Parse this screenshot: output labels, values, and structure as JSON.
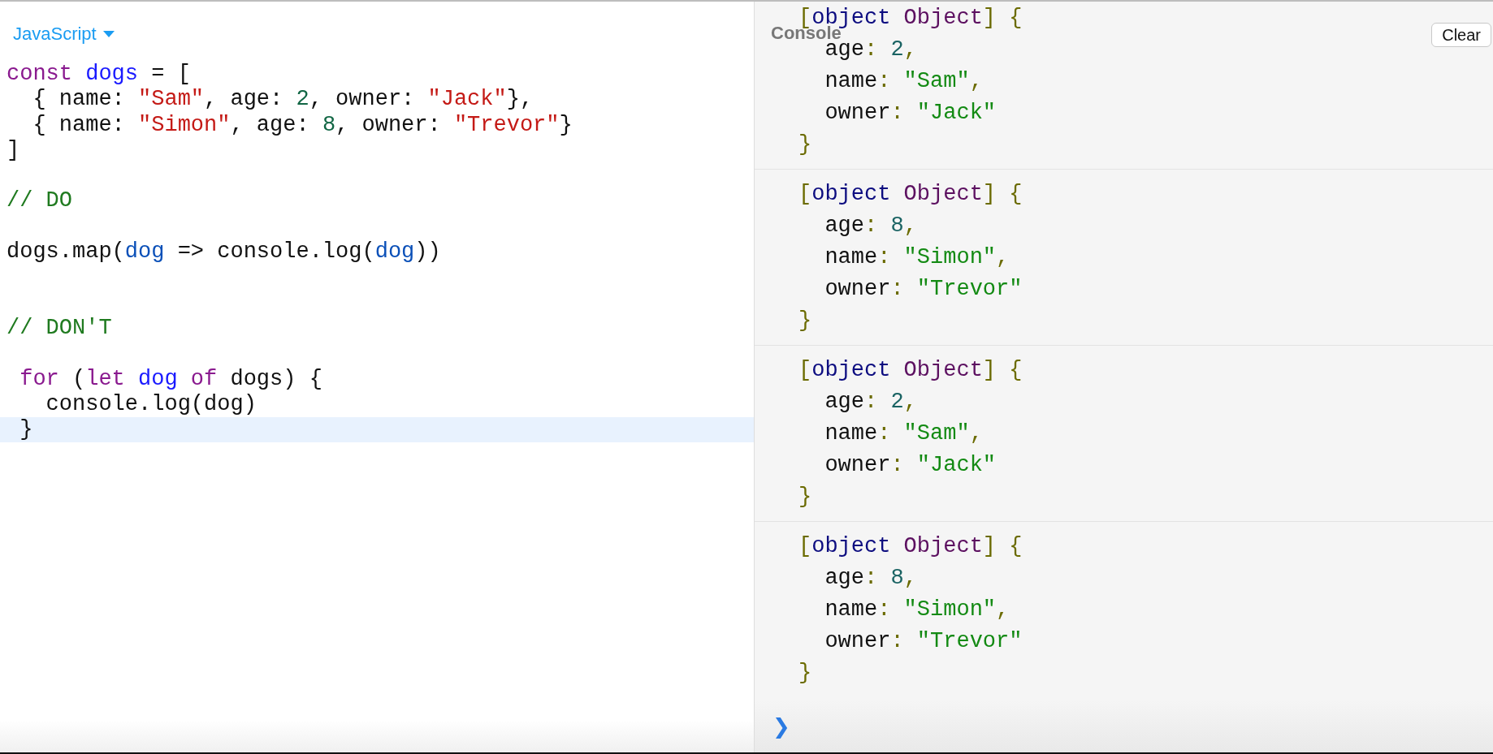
{
  "editor": {
    "language": "JavaScript",
    "lines": [
      {
        "kind": "code",
        "highlighted": false,
        "tokens": [
          {
            "kind": "keyword",
            "text": "const"
          },
          {
            "kind": "def",
            "text": " dogs"
          },
          {
            "kind": "plain",
            "text": " = ["
          }
        ]
      },
      {
        "kind": "code",
        "highlighted": false,
        "tokens": [
          {
            "kind": "plain",
            "text": "  { name: "
          },
          {
            "kind": "string",
            "text": "\"Sam\""
          },
          {
            "kind": "plain",
            "text": ", age: "
          },
          {
            "kind": "number",
            "text": "2"
          },
          {
            "kind": "plain",
            "text": ", owner: "
          },
          {
            "kind": "string",
            "text": "\"Jack\""
          },
          {
            "kind": "plain",
            "text": "},"
          }
        ]
      },
      {
        "kind": "code",
        "highlighted": false,
        "tokens": [
          {
            "kind": "plain",
            "text": "  { name: "
          },
          {
            "kind": "string",
            "text": "\"Simon\""
          },
          {
            "kind": "plain",
            "text": ", age: "
          },
          {
            "kind": "number",
            "text": "8"
          },
          {
            "kind": "plain",
            "text": ", owner: "
          },
          {
            "kind": "string",
            "text": "\"Trevor\""
          },
          {
            "kind": "plain",
            "text": "}"
          }
        ]
      },
      {
        "kind": "code",
        "highlighted": false,
        "tokens": [
          {
            "kind": "plain",
            "text": "]"
          }
        ]
      },
      {
        "kind": "blank"
      },
      {
        "kind": "code",
        "highlighted": false,
        "tokens": [
          {
            "kind": "comment",
            "text": "// DO"
          }
        ]
      },
      {
        "kind": "blank"
      },
      {
        "kind": "code",
        "highlighted": false,
        "tokens": [
          {
            "kind": "plain",
            "text": "dogs.map("
          },
          {
            "kind": "variable",
            "text": "dog"
          },
          {
            "kind": "plain",
            "text": " => console.log("
          },
          {
            "kind": "variable",
            "text": "dog"
          },
          {
            "kind": "plain",
            "text": "))"
          }
        ]
      },
      {
        "kind": "blank"
      },
      {
        "kind": "blank"
      },
      {
        "kind": "code",
        "highlighted": false,
        "tokens": [
          {
            "kind": "comment",
            "text": "// DON'T"
          }
        ]
      },
      {
        "kind": "blank"
      },
      {
        "kind": "code",
        "highlighted": false,
        "tokens": [
          {
            "kind": "keyword",
            "text": " for"
          },
          {
            "kind": "plain",
            "text": " ("
          },
          {
            "kind": "keyword",
            "text": "let"
          },
          {
            "kind": "def",
            "text": " dog"
          },
          {
            "kind": "keyword",
            "text": " of"
          },
          {
            "kind": "plain",
            "text": " dogs) {"
          }
        ]
      },
      {
        "kind": "code",
        "highlighted": false,
        "tokens": [
          {
            "kind": "plain",
            "text": "   console.log(dog)"
          }
        ]
      },
      {
        "kind": "code",
        "highlighted": true,
        "tokens": [
          {
            "kind": "plain",
            "text": " }"
          }
        ]
      }
    ]
  },
  "console": {
    "title": "Console",
    "clear_button": "Clear",
    "entries": [
      {
        "lines": [
          [
            {
              "kind": "punct",
              "text": "["
            },
            {
              "kind": "type",
              "text": "object"
            },
            {
              "kind": "class",
              "text": " Object"
            },
            {
              "kind": "punct",
              "text": "]"
            },
            {
              "kind": "punct",
              "text": " {"
            }
          ],
          [
            {
              "kind": "key",
              "text": "  age"
            },
            {
              "kind": "punct",
              "text": ":"
            },
            {
              "kind": "num_value",
              "text": " 2"
            },
            {
              "kind": "punct",
              "text": ","
            }
          ],
          [
            {
              "kind": "key",
              "text": "  name"
            },
            {
              "kind": "punct",
              "text": ":"
            },
            {
              "kind": "text_value",
              "text": " \"Sam\""
            },
            {
              "kind": "punct",
              "text": ","
            }
          ],
          [
            {
              "kind": "key",
              "text": "  owner"
            },
            {
              "kind": "punct",
              "text": ":"
            },
            {
              "kind": "text_value",
              "text": " \"Jack\""
            }
          ],
          [
            {
              "kind": "punct",
              "text": "}"
            }
          ]
        ]
      },
      {
        "lines": [
          [
            {
              "kind": "punct",
              "text": "["
            },
            {
              "kind": "type",
              "text": "object"
            },
            {
              "kind": "class",
              "text": " Object"
            },
            {
              "kind": "punct",
              "text": "]"
            },
            {
              "kind": "punct",
              "text": " {"
            }
          ],
          [
            {
              "kind": "key",
              "text": "  age"
            },
            {
              "kind": "punct",
              "text": ":"
            },
            {
              "kind": "num_value",
              "text": " 8"
            },
            {
              "kind": "punct",
              "text": ","
            }
          ],
          [
            {
              "kind": "key",
              "text": "  name"
            },
            {
              "kind": "punct",
              "text": ":"
            },
            {
              "kind": "text_value",
              "text": " \"Simon\""
            },
            {
              "kind": "punct",
              "text": ","
            }
          ],
          [
            {
              "kind": "key",
              "text": "  owner"
            },
            {
              "kind": "punct",
              "text": ":"
            },
            {
              "kind": "text_value",
              "text": " \"Trevor\""
            }
          ],
          [
            {
              "kind": "punct",
              "text": "}"
            }
          ]
        ]
      },
      {
        "lines": [
          [
            {
              "kind": "punct",
              "text": "["
            },
            {
              "kind": "type",
              "text": "object"
            },
            {
              "kind": "class",
              "text": " Object"
            },
            {
              "kind": "punct",
              "text": "]"
            },
            {
              "kind": "punct",
              "text": " {"
            }
          ],
          [
            {
              "kind": "key",
              "text": "  age"
            },
            {
              "kind": "punct",
              "text": ":"
            },
            {
              "kind": "num_value",
              "text": " 2"
            },
            {
              "kind": "punct",
              "text": ","
            }
          ],
          [
            {
              "kind": "key",
              "text": "  name"
            },
            {
              "kind": "punct",
              "text": ":"
            },
            {
              "kind": "text_value",
              "text": " \"Sam\""
            },
            {
              "kind": "punct",
              "text": ","
            }
          ],
          [
            {
              "kind": "key",
              "text": "  owner"
            },
            {
              "kind": "punct",
              "text": ":"
            },
            {
              "kind": "text_value",
              "text": " \"Jack\""
            }
          ],
          [
            {
              "kind": "punct",
              "text": "}"
            }
          ]
        ]
      },
      {
        "lines": [
          [
            {
              "kind": "punct",
              "text": "["
            },
            {
              "kind": "type",
              "text": "object"
            },
            {
              "kind": "class",
              "text": " Object"
            },
            {
              "kind": "punct",
              "text": "]"
            },
            {
              "kind": "punct",
              "text": " {"
            }
          ],
          [
            {
              "kind": "key",
              "text": "  age"
            },
            {
              "kind": "punct",
              "text": ":"
            },
            {
              "kind": "num_value",
              "text": " 8"
            },
            {
              "kind": "punct",
              "text": ","
            }
          ],
          [
            {
              "kind": "key",
              "text": "  name"
            },
            {
              "kind": "punct",
              "text": ":"
            },
            {
              "kind": "text_value",
              "text": " \"Simon\""
            },
            {
              "kind": "punct",
              "text": ","
            }
          ],
          [
            {
              "kind": "key",
              "text": "  owner"
            },
            {
              "kind": "punct",
              "text": ":"
            },
            {
              "kind": "text_value",
              "text": " \"Trevor\""
            }
          ],
          [
            {
              "kind": "punct",
              "text": "}"
            }
          ]
        ]
      }
    ],
    "prompt": "❯"
  }
}
